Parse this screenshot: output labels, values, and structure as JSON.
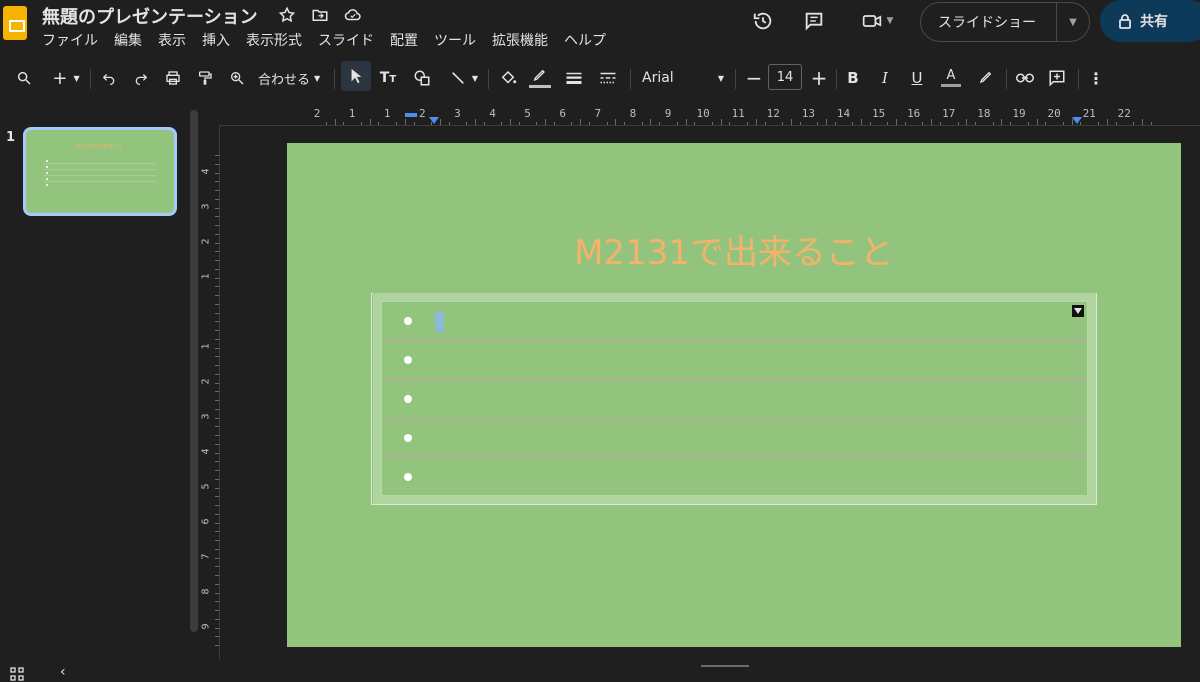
{
  "header": {
    "doc_title": "無題のプレゼンテーション",
    "menu": [
      "ファイル",
      "編集",
      "表示",
      "挿入",
      "表示形式",
      "スライド",
      "配置",
      "ツール",
      "拡張機能",
      "ヘルプ"
    ],
    "slideshow_label": "スライドショー",
    "share_label": "共有"
  },
  "toolbar": {
    "zoom_label": "合わせる",
    "font_name": "Arial",
    "font_size": "14"
  },
  "filmstrip": {
    "slide_number": "1",
    "thumb_title": "M2131で出来ること"
  },
  "ruler": {
    "h_labels": [
      "2",
      "1",
      "1",
      "2",
      "3",
      "4",
      "5",
      "6",
      "7",
      "8",
      "9",
      "10",
      "11",
      "12",
      "13",
      "14",
      "15",
      "16",
      "17",
      "18",
      "19",
      "20",
      "21",
      "22"
    ],
    "v_labels": [
      "4",
      "3",
      "2",
      "1",
      "1",
      "2",
      "3",
      "4",
      "5",
      "6",
      "7",
      "8",
      "9"
    ]
  },
  "slide": {
    "title": "M2131で出来ること",
    "bullets": [
      "",
      "",
      "",
      "",
      ""
    ],
    "background_color": "#93c47d",
    "title_color": "#f6b26b"
  },
  "icons": [
    "star-icon",
    "move-folder-icon",
    "cloud-icon",
    "history-icon",
    "comment-icon",
    "meet-icon",
    "lock-icon",
    "search-icon",
    "plus-icon",
    "undo-icon",
    "redo-icon",
    "print-icon",
    "paint-format-icon",
    "zoom-icon",
    "select-icon",
    "textbox-icon",
    "shape-icon",
    "line-icon",
    "fill-color-icon",
    "border-color-icon",
    "border-weight-icon",
    "border-dash-icon",
    "bold-icon",
    "italic-icon",
    "underline-icon",
    "text-color-icon",
    "highlight-icon",
    "link-icon",
    "comment-add-icon",
    "more-icon",
    "grid-view-icon",
    "collapse-icon"
  ]
}
